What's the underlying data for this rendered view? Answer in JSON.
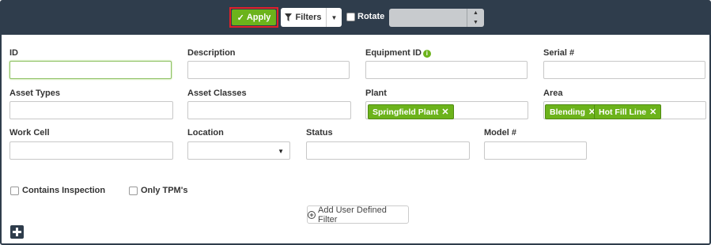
{
  "toolbar": {
    "apply_label": "Apply",
    "filters_label": "Filters",
    "rotate_label": "Rotate",
    "rotate_value": ""
  },
  "fields": {
    "id": {
      "label": "ID",
      "value": ""
    },
    "description": {
      "label": "Description",
      "value": ""
    },
    "equipment_id": {
      "label": "Equipment ID",
      "value": ""
    },
    "serial": {
      "label": "Serial #",
      "value": ""
    },
    "asset_types": {
      "label": "Asset Types",
      "value": ""
    },
    "asset_classes": {
      "label": "Asset Classes",
      "value": ""
    },
    "plant": {
      "label": "Plant",
      "tags": [
        "Springfield Plant"
      ]
    },
    "area": {
      "label": "Area",
      "tags": [
        "Blending",
        "Hot Fill Line"
      ]
    },
    "work_cell": {
      "label": "Work Cell",
      "value": ""
    },
    "location": {
      "label": "Location",
      "value": ""
    },
    "status": {
      "label": "Status",
      "value": ""
    },
    "model": {
      "label": "Model #",
      "value": ""
    }
  },
  "checkboxes": {
    "contains_inspection": {
      "label": "Contains Inspection",
      "checked": false
    },
    "only_tpm": {
      "label": "Only TPM's",
      "checked": false
    }
  },
  "add_udf_label": "Add User Defined Filter",
  "colors": {
    "header_bg": "#2f3d4c",
    "accent_green": "#6cb31b",
    "highlight_red": "#e0202a"
  }
}
